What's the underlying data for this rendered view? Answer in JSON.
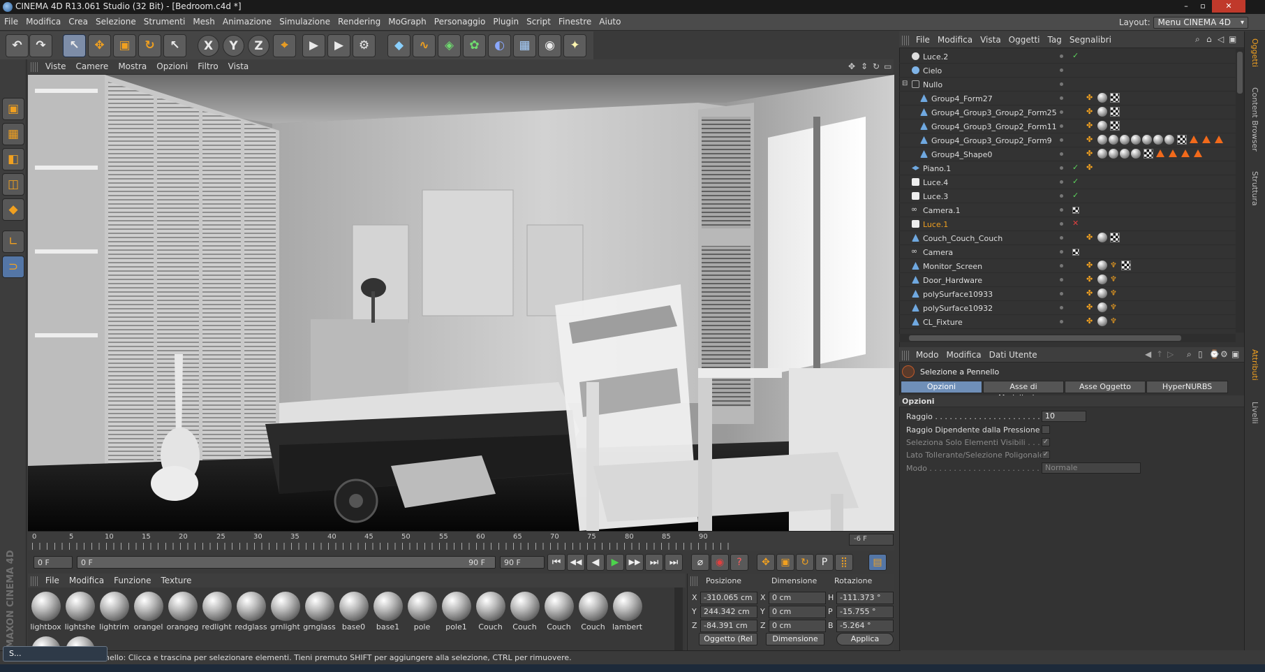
{
  "window": {
    "title": "CINEMA 4D R13.061 Studio (32 Bit) - [Bedroom.c4d *]",
    "controls": [
      "–",
      "▫",
      "✕"
    ]
  },
  "menubar": {
    "items": [
      "File",
      "Modifica",
      "Crea",
      "Selezione",
      "Strumenti",
      "Mesh",
      "Animazione",
      "Simulazione",
      "Rendering",
      "MoGraph",
      "Personaggio",
      "Plugin",
      "Script",
      "Finestre",
      "Aiuto"
    ],
    "layout_label": "Layout:",
    "layout_value": "Menu CINEMA 4D"
  },
  "toolbar": {
    "undo": "↶",
    "redo": "↷",
    "live_select": "↖",
    "move": "✥",
    "scale": "▣",
    "rotate": "↻",
    "last_tool": "↖",
    "axis_x": "X",
    "axis_y": "Y",
    "axis_z": "Z",
    "world": "⌖",
    "render_view": "▶",
    "render_pic": "▶",
    "render_settings": "⚙",
    "cube": "◆",
    "spline": "∿",
    "nurbs": "◈",
    "array": "✿",
    "deformer": "◐",
    "scene": "▦",
    "camera": "◉",
    "light": "✦"
  },
  "left_tools": [
    "▣",
    "▦",
    "◧",
    "◫",
    "◆",
    "∟",
    "⊃"
  ],
  "viewport_menu": [
    "Viste",
    "Camere",
    "Mostra",
    "Opzioni",
    "Filtro",
    "Vista"
  ],
  "viewport_controls": [
    "✥",
    "⇕",
    "↻",
    "▭"
  ],
  "timeline": {
    "ticks": [
      "0",
      "5",
      "10",
      "15",
      "20",
      "25",
      "30",
      "35",
      "40",
      "45",
      "50",
      "55",
      "60",
      "65",
      "70",
      "75",
      "80",
      "85",
      "90"
    ],
    "current_frame": "-6 F"
  },
  "transport": {
    "start_field": "0 F",
    "range_start": "0 F",
    "range_end": "90 F",
    "end_field": "90 F",
    "buttons": [
      "⏮",
      "◀◀",
      "◀",
      "▶",
      "▶▶",
      "⏭",
      "⏭"
    ],
    "key_buttons": [
      "⌀",
      "◉",
      "?",
      "✥",
      "▣",
      "↻",
      "P",
      "⣿",
      "▤"
    ]
  },
  "materials": {
    "menu": [
      "File",
      "Modifica",
      "Funzione",
      "Texture"
    ],
    "items": [
      "lightbox",
      "lightshe",
      "lightrim",
      "orangel",
      "orangeg",
      "redlight",
      "redglass",
      "grnlight",
      "grnglass",
      "base0",
      "base1",
      "pole",
      "pole1",
      "Couch",
      "Couch",
      "Couch",
      "Couch",
      "lambert"
    ]
  },
  "coords": {
    "headers": [
      "Posizione",
      "Dimensione",
      "Rotazione"
    ],
    "rows": [
      {
        "axis": "X",
        "pos": "-310.065 cm",
        "dim_axis": "X",
        "dim": "0 cm",
        "rot_axis": "H",
        "rot": "-111.373 °"
      },
      {
        "axis": "Y",
        "pos": "244.342 cm",
        "dim_axis": "Y",
        "dim": "0 cm",
        "rot_axis": "P",
        "rot": "-15.755 °"
      },
      {
        "axis": "Z",
        "pos": "-84.391 cm",
        "dim_axis": "Z",
        "dim": "0 cm",
        "rot_axis": "B",
        "rot": "-5.264 °"
      }
    ],
    "mode_select": "Oggetto (Rel",
    "dim_select": "Dimensione",
    "apply_button": "Applica"
  },
  "status": {
    "text": "nello: Clicca e trascina per selezionare elementi. Tieni premuto SHIFT per aggiungere alla selezione, CTRL per rimuovere."
  },
  "taskbar": {
    "chip_label": "S..."
  },
  "maxon": "MAXON CINEMA 4D",
  "objects": {
    "menu": [
      "File",
      "Modifica",
      "Vista",
      "Oggetti",
      "Tag",
      "Segnalibri"
    ],
    "rows": [
      {
        "name": "Luce.2",
        "check": "✓"
      },
      {
        "name": "Cielo",
        "check": ""
      },
      {
        "name": "Nullo",
        "check": ""
      },
      {
        "name": "Group4_Form27",
        "check": ""
      },
      {
        "name": "Group4_Group3_Group2_Form25",
        "check": ""
      },
      {
        "name": "Group4_Group3_Group2_Form11",
        "check": ""
      },
      {
        "name": "Group4_Group3_Group2_Form9",
        "check": ""
      },
      {
        "name": "Group4_Shape0",
        "check": ""
      },
      {
        "name": "Piano.1",
        "check": "✓"
      },
      {
        "name": "Luce.4",
        "check": "✓"
      },
      {
        "name": "Luce.3",
        "check": "✓"
      },
      {
        "name": "Camera.1",
        "check": ""
      },
      {
        "name": "Luce.1",
        "check": "✕"
      },
      {
        "name": "Couch_Couch_Couch",
        "check": ""
      },
      {
        "name": "Camera",
        "check": ""
      },
      {
        "name": "Monitor_Screen",
        "check": ""
      },
      {
        "name": "Door_Hardware",
        "check": ""
      },
      {
        "name": "polySurface10933",
        "check": ""
      },
      {
        "name": "polySurface10932",
        "check": ""
      },
      {
        "name": "CL_Fixture",
        "check": ""
      }
    ]
  },
  "attributes": {
    "menu": [
      "Modo",
      "Modifica",
      "Dati Utente"
    ],
    "tool_name": "Selezione a Pennello",
    "tabs": [
      "Opzioni",
      "Asse di Modellazione",
      "Asse Oggetto",
      "HyperNURBS"
    ],
    "section": "Opzioni",
    "fields": {
      "radius_label": "Raggio . . . . . . . . . . . . . . . . . . . . . . . .",
      "radius_value": "10",
      "pressure_label": "Raggio Dipendente dalla Pressione",
      "visible_label": "Seleziona Solo Elementi Visibili . . . .",
      "visible_check": "✓",
      "tolerant_label": "Lato Tollerante/Selezione Poligonale",
      "tolerant_check": "✓",
      "mode_label": "Modo . . . . . . . . . . . . . . . . . . . . . . . . .",
      "mode_value": "Normale"
    }
  },
  "side_tabs": [
    "Oggetti",
    "Content Browser",
    "Struttura",
    "Attributi",
    "Livelli"
  ],
  "colors": {
    "accent": "#5476a6",
    "selected_object": "#f0a020"
  }
}
